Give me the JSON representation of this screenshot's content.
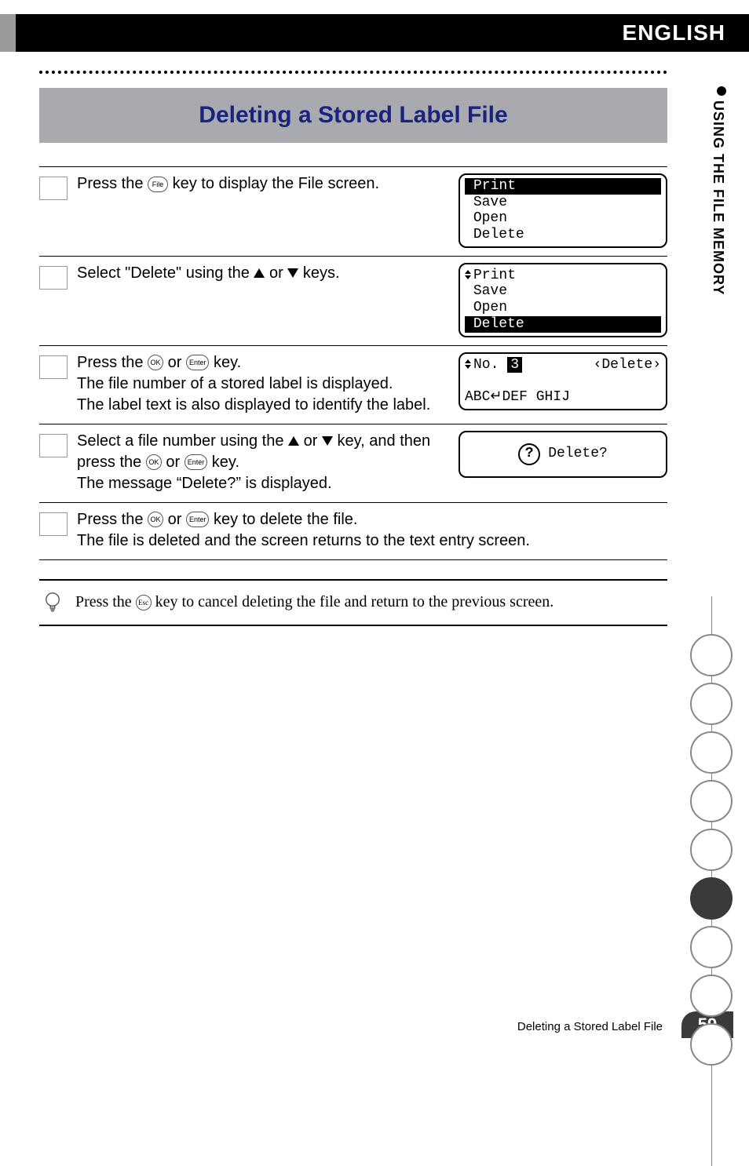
{
  "header": {
    "language": "ENGLISH"
  },
  "sidebar": {
    "section": "USING THE FILE MEMORY"
  },
  "title": "Deleting a Stored Label File",
  "steps": [
    {
      "text_before": "Press the ",
      "key1": "File",
      "text_after": " key to display the File screen.",
      "lcd": {
        "type": "menu",
        "items": [
          "Print",
          "Save",
          "Open",
          "Delete"
        ],
        "selected": 0
      }
    },
    {
      "text_before": "Select \"Delete\" using the ",
      "text_mid": " or ",
      "text_after": "  keys.",
      "lcd": {
        "type": "menu",
        "items": [
          "Print",
          "Save",
          "Open",
          "Delete"
        ],
        "selected": 3
      }
    },
    {
      "text_before": "Press the ",
      "key1": "OK",
      "text_mid": " or ",
      "key2": "Enter",
      "text_after": " key.",
      "line2": "The file number of a stored label is displayed.",
      "line3": "The label text is also displayed to identify the label.",
      "lcd": {
        "type": "file",
        "no_label": "No.",
        "no_value": "3",
        "mode": "‹Delete›",
        "content": "ABC↵DEF GHIJ"
      }
    },
    {
      "text_before": "Select a file number using the ",
      "text_mid": " or ",
      "text_after2": " key, and then press the ",
      "key1": "OK",
      "text_mid2": " or ",
      "key2": "Enter",
      "text_after3": " key.",
      "line2": "The message “Delete?” is displayed.",
      "lcd": {
        "type": "confirm",
        "msg": "Delete?"
      }
    },
    {
      "text_before": "Press the ",
      "key1": "OK",
      "text_mid": " or ",
      "key2": "Enter",
      "text_after": " key to delete the file.",
      "line2": "The file is deleted and the screen returns to the text entry screen."
    }
  ],
  "note": {
    "before": "Press the ",
    "key": "Esc",
    "after": " key to cancel deleting the file and return to the previous screen."
  },
  "footer": {
    "caption": "Deleting a Stored Label File",
    "page": "59"
  },
  "progress": {
    "total": 9,
    "filled_index": 5
  }
}
